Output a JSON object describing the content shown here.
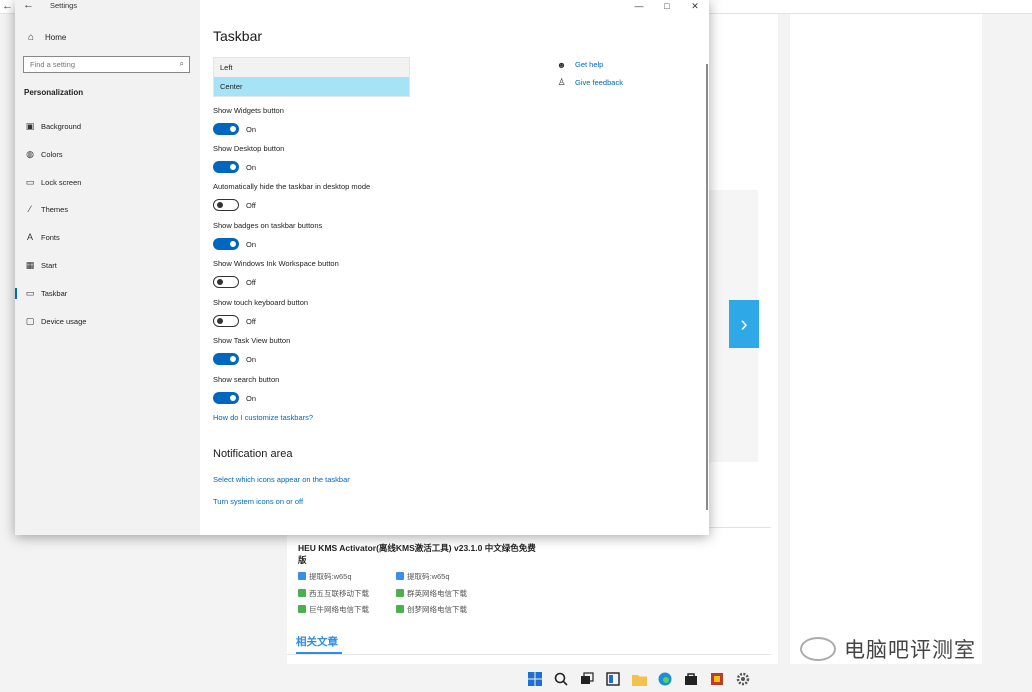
{
  "window": {
    "title": "Settings"
  },
  "sidebar": {
    "home": "Home",
    "search_placeholder": "Find a setting",
    "section": "Personalization",
    "items": [
      {
        "label": "Background",
        "icon": "image-icon"
      },
      {
        "label": "Colors",
        "icon": "palette-icon"
      },
      {
        "label": "Lock screen",
        "icon": "lock-screen-icon"
      },
      {
        "label": "Themes",
        "icon": "brush-icon"
      },
      {
        "label": "Fonts",
        "icon": "font-icon"
      },
      {
        "label": "Start",
        "icon": "start-grid-icon"
      },
      {
        "label": "Taskbar",
        "icon": "taskbar-icon",
        "active": true
      },
      {
        "label": "Device usage",
        "icon": "device-icon"
      }
    ]
  },
  "main": {
    "title": "Taskbar",
    "dropdown": {
      "options": [
        "Left",
        "Center"
      ],
      "selected": "Center"
    },
    "settings": [
      {
        "label": "Show Widgets button",
        "state": "On"
      },
      {
        "label": "Show Desktop button",
        "state": "On"
      },
      {
        "label": "Automatically hide the taskbar in desktop mode",
        "state": "Off"
      },
      {
        "label": "Show badges on taskbar buttons",
        "state": "On"
      },
      {
        "label": "Show Windows Ink Workspace button",
        "state": "Off"
      },
      {
        "label": "Show touch keyboard button",
        "state": "Off"
      },
      {
        "label": "Show Task View button",
        "state": "On"
      },
      {
        "label": "Show search button",
        "state": "On"
      }
    ],
    "customize_link": "How do I customize taskbars?",
    "notification_title": "Notification area",
    "notification_links": [
      "Select which icons appear on the taskbar",
      "Turn system icons on or off"
    ],
    "help": {
      "get_help": "Get help",
      "give_feedback": "Give feedback"
    }
  },
  "background_page": {
    "article_title": "HEU KMS Activator(离线KMS激活工具) v23.1.0 中文绿色免费版",
    "links_left": [
      "提取码:w65q",
      "西五互联移动下载",
      "巨牛网络电信下载"
    ],
    "links_right": [
      "提取码:w65q",
      "群英网络电信下载",
      "创梦网络电信下载"
    ],
    "related": "相关文章",
    "watermark": "电脑吧评测室"
  },
  "colors": {
    "accent": "#0067c0",
    "selected": "#a7e3f7",
    "page_blue": "#2fa8e8"
  }
}
